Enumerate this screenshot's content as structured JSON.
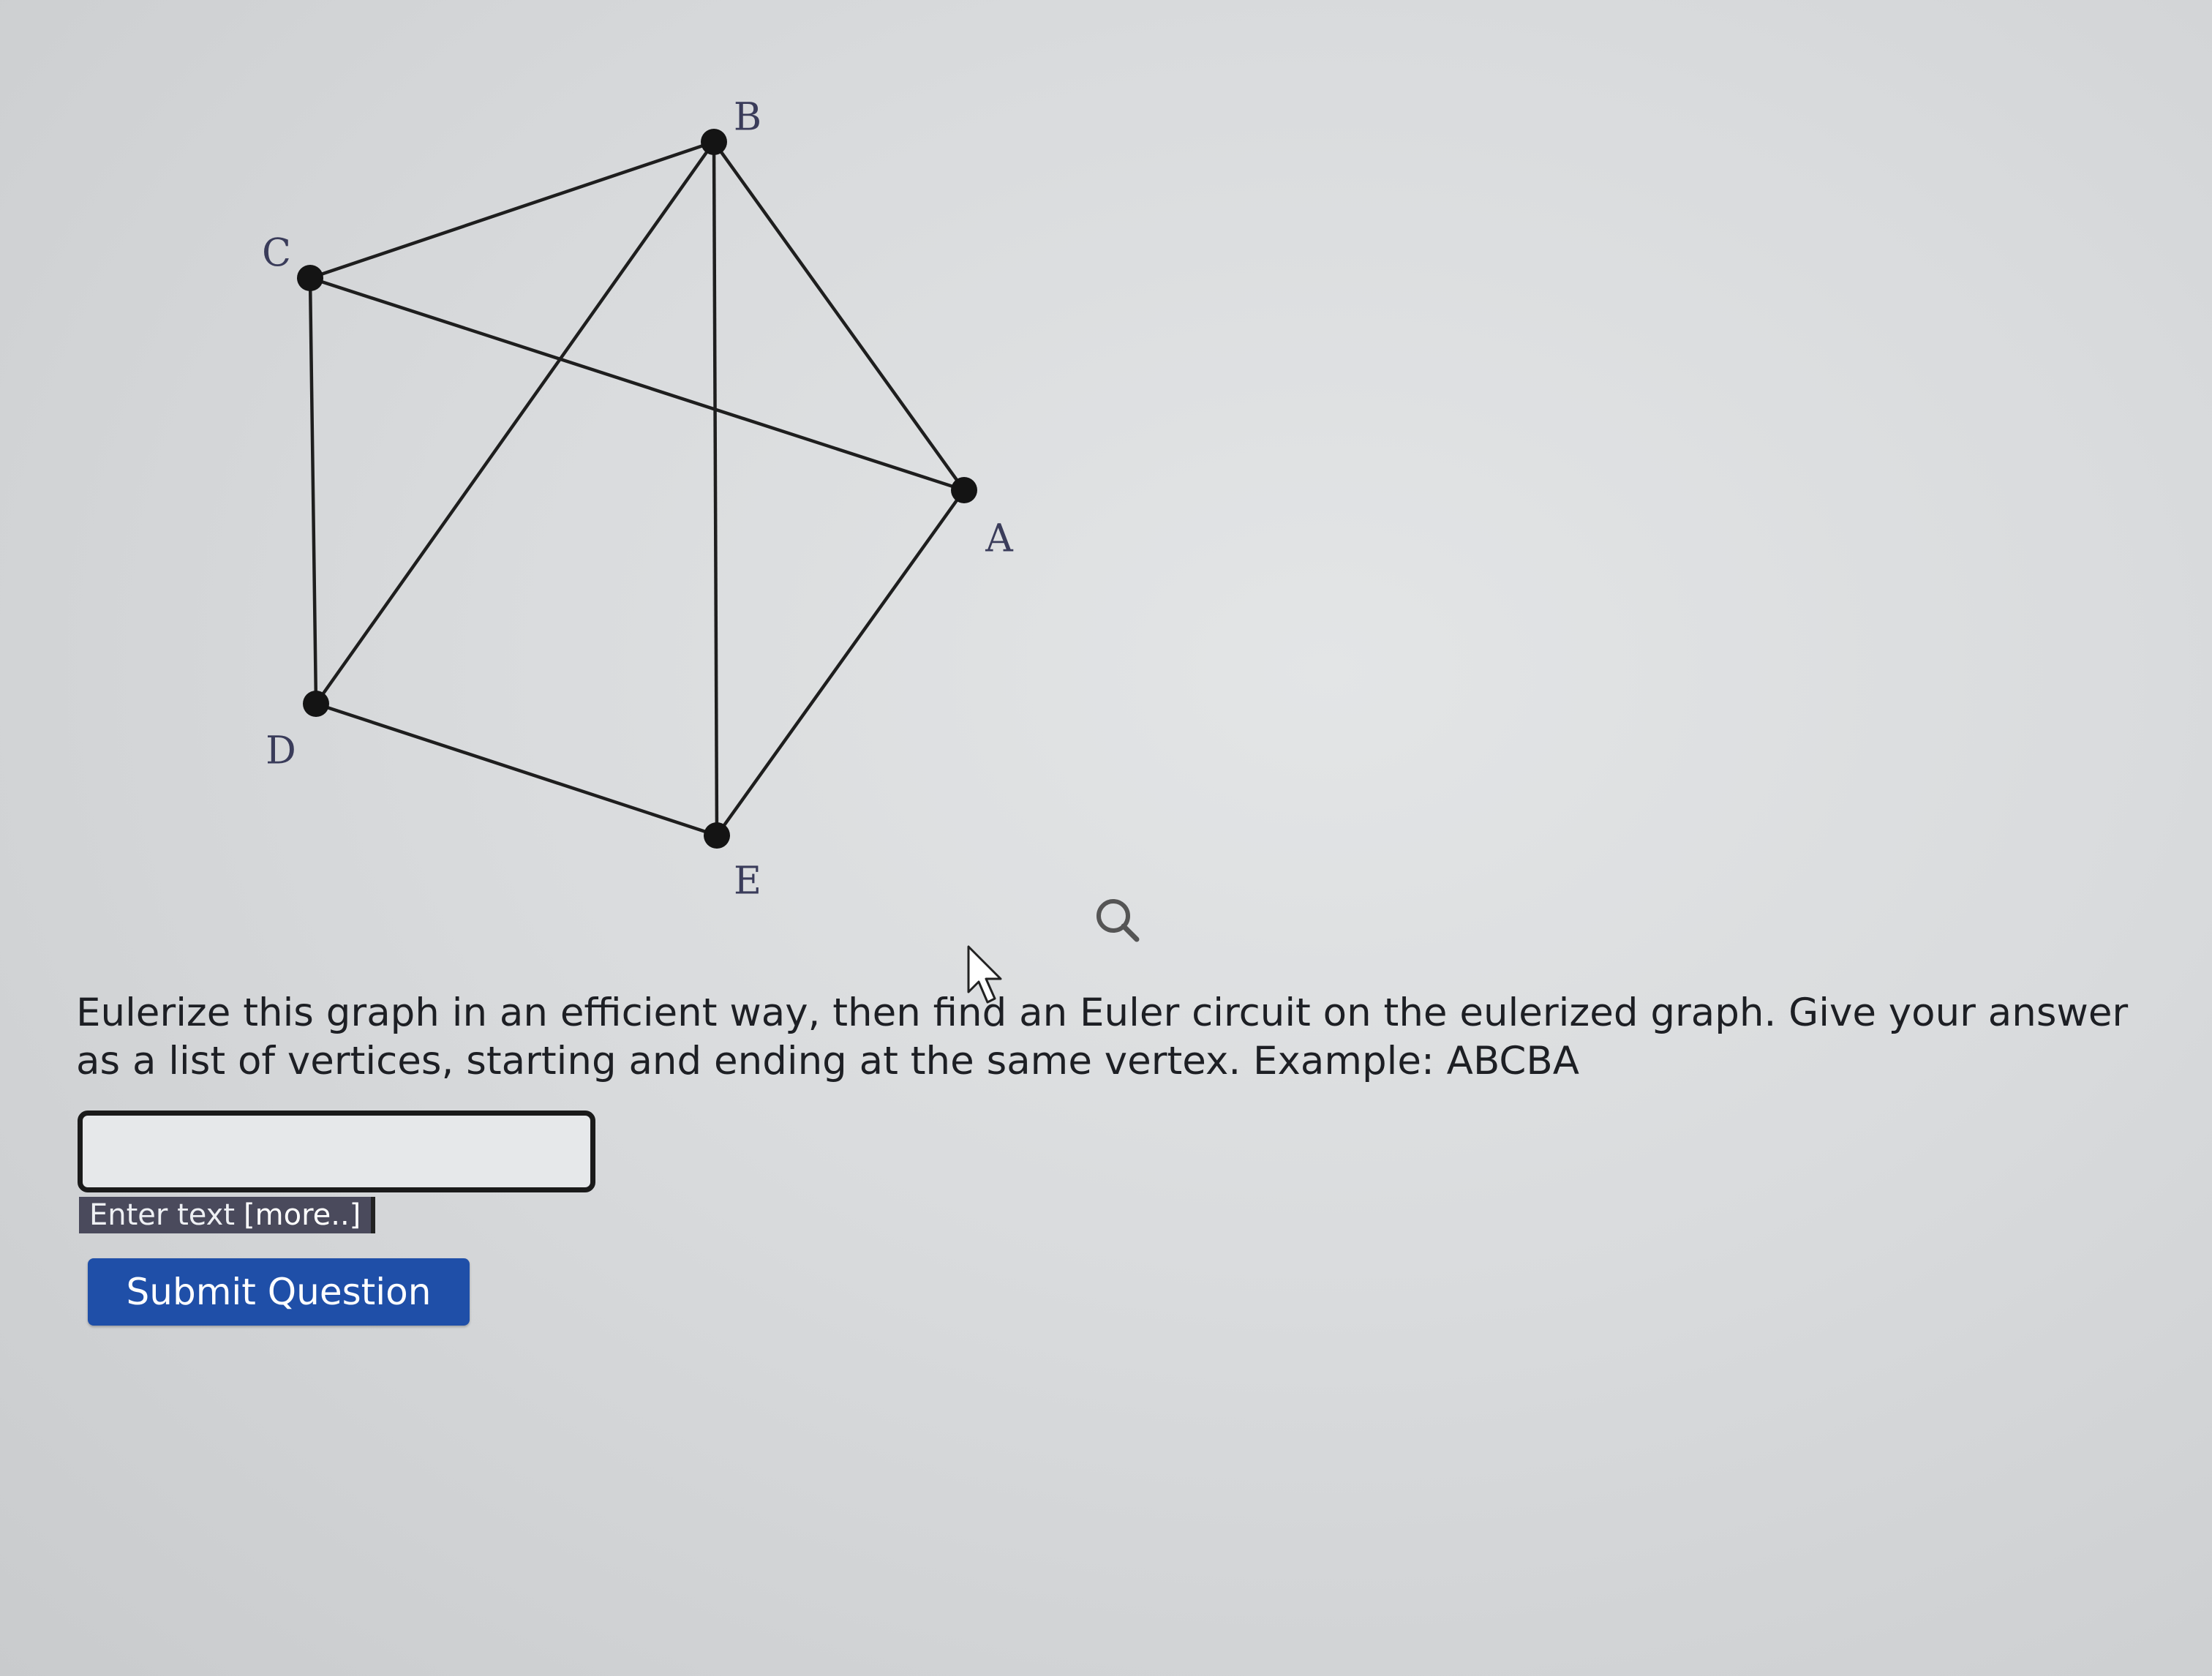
{
  "graph": {
    "vertices": [
      {
        "id": "A",
        "label": "A"
      },
      {
        "id": "B",
        "label": "B"
      },
      {
        "id": "C",
        "label": "C"
      },
      {
        "id": "D",
        "label": "D"
      },
      {
        "id": "E",
        "label": "E"
      }
    ],
    "edges": [
      [
        "C",
        "B"
      ],
      [
        "B",
        "A"
      ],
      [
        "B",
        "D"
      ],
      [
        "B",
        "E"
      ],
      [
        "C",
        "A"
      ],
      [
        "C",
        "D"
      ],
      [
        "A",
        "E"
      ],
      [
        "D",
        "E"
      ]
    ]
  },
  "question": {
    "text": "Eulerize this graph in an efficient way, then find an Euler circuit on the eulerized graph. Give your answer as a list of vertices, starting and ending at the same vertex. Example: ABCBA"
  },
  "answer": {
    "value": "",
    "placeholder": ""
  },
  "helper": {
    "label": "Enter text",
    "more_link": "[more..]"
  },
  "actions": {
    "submit_label": "Submit Question"
  },
  "icons": {
    "magnifier": "magnifier-icon",
    "cursor": "mouse-pointer-icon"
  },
  "colors": {
    "submit_bg": "#1f4fa8",
    "helper_bg": "#4a4a5c",
    "vertex_label": "#3a3c5a"
  }
}
